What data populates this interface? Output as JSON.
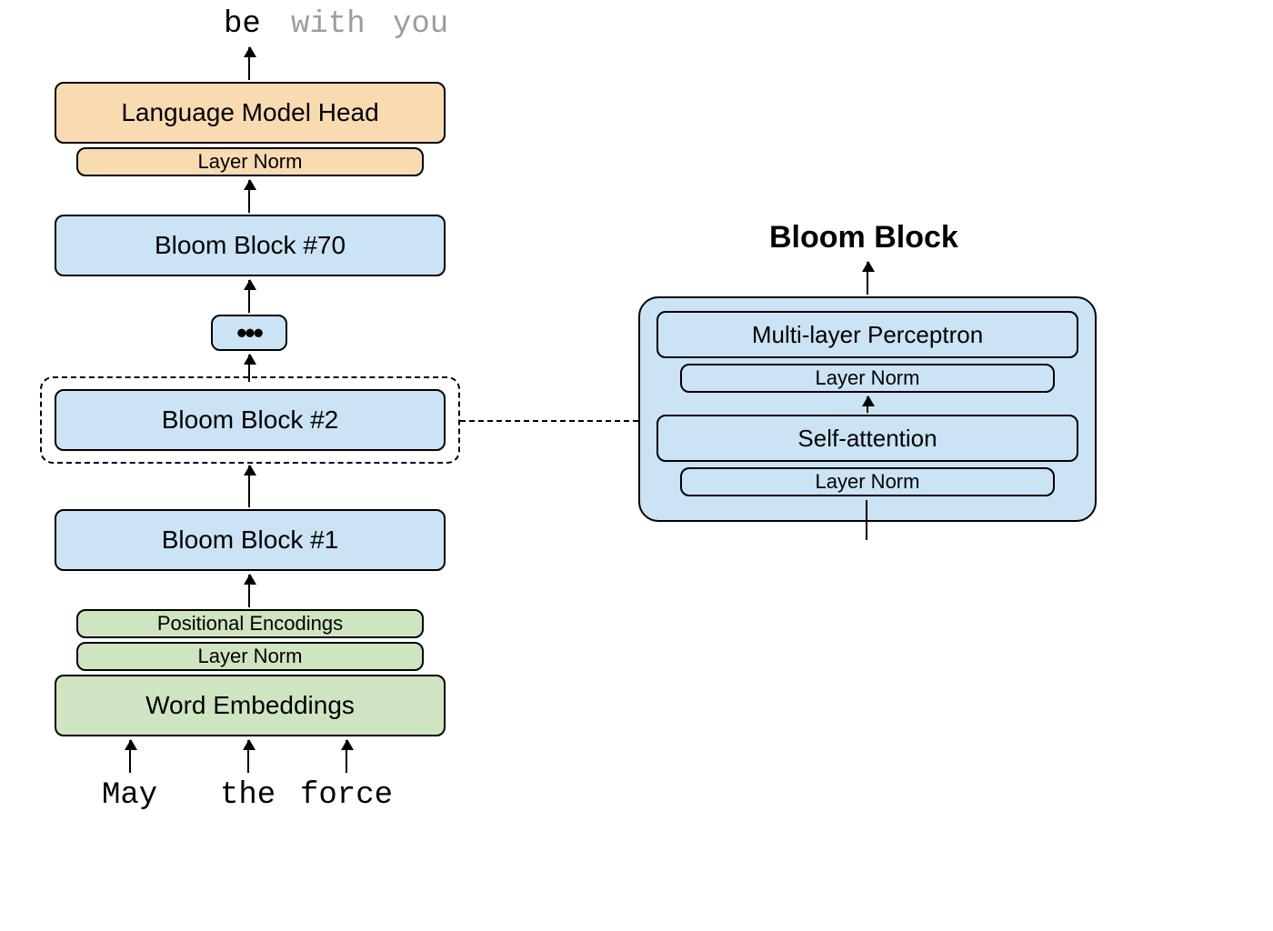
{
  "outputs": {
    "w1": "be",
    "w2": "with",
    "w3": "you"
  },
  "main_stack": {
    "lm_head": "Language Model Head",
    "layer_norm_top": "Layer Norm",
    "block_70": "Bloom Block #70",
    "block_2": "Bloom Block #2",
    "block_1": "Bloom Block #1",
    "pos_enc": "Positional Encodings",
    "layer_norm_bottom": "Layer Norm",
    "word_emb": "Word Embeddings"
  },
  "inputs": {
    "w1": "May",
    "w2": "the",
    "w3": "force"
  },
  "detail": {
    "title": "Bloom Block",
    "mlp": "Multi-layer Perceptron",
    "ln1": "Layer Norm",
    "self_attn": "Self-attention",
    "ln2": "Layer Norm"
  }
}
